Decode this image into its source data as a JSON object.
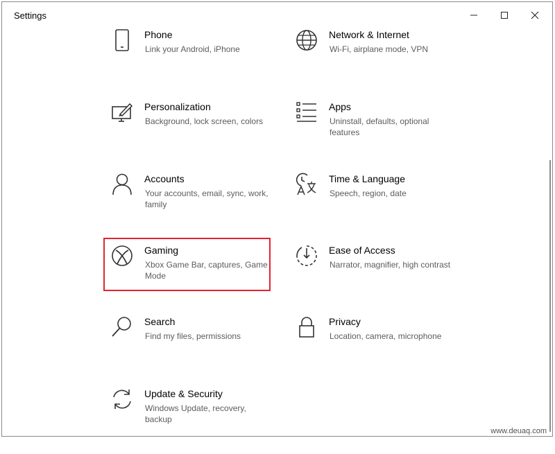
{
  "window": {
    "title": "Settings",
    "controls": {
      "minimize": "minimize",
      "maximize": "maximize",
      "close": "close"
    }
  },
  "categories": [
    {
      "id": "phone",
      "title": "Phone",
      "description": "Link your Android, iPhone",
      "icon": "phone-icon"
    },
    {
      "id": "network",
      "title": "Network & Internet",
      "description": "Wi-Fi, airplane mode, VPN",
      "icon": "globe-icon"
    },
    {
      "id": "personalization",
      "title": "Personalization",
      "description": "Background, lock screen, colors",
      "icon": "personalization-icon"
    },
    {
      "id": "apps",
      "title": "Apps",
      "description": "Uninstall, defaults, optional features",
      "icon": "apps-list-icon"
    },
    {
      "id": "accounts",
      "title": "Accounts",
      "description": "Your accounts, email, sync, work, family",
      "icon": "person-icon"
    },
    {
      "id": "time-language",
      "title": "Time & Language",
      "description": "Speech, region, date",
      "icon": "time-language-icon"
    },
    {
      "id": "gaming",
      "title": "Gaming",
      "description": "Xbox Game Bar, captures, Game Mode",
      "icon": "xbox-icon",
      "highlighted": true
    },
    {
      "id": "ease-of-access",
      "title": "Ease of Access",
      "description": "Narrator, magnifier, high contrast",
      "icon": "ease-of-access-icon"
    },
    {
      "id": "search",
      "title": "Search",
      "description": "Find my files, permissions",
      "icon": "search-icon"
    },
    {
      "id": "privacy",
      "title": "Privacy",
      "description": "Location, camera, microphone",
      "icon": "lock-icon"
    },
    {
      "id": "update-security",
      "title": "Update & Security",
      "description": "Windows Update, recovery, backup",
      "icon": "sync-icon"
    }
  ],
  "highlight_color": "#e0232e",
  "watermark": "www.deuaq.com"
}
